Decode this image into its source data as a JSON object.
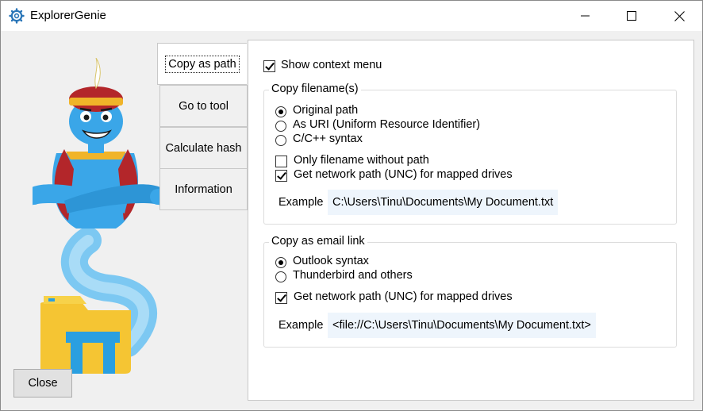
{
  "window": {
    "title": "ExplorerGenie",
    "minimize": "minimize",
    "maximize": "maximize",
    "close": "close"
  },
  "sidebar": {
    "close_label": "Close"
  },
  "tabs": [
    {
      "label": "Copy as path",
      "active": true
    },
    {
      "label": "Go to tool",
      "active": false
    },
    {
      "label": "Calculate hash",
      "active": false
    },
    {
      "label": "Information",
      "active": false
    }
  ],
  "panel": {
    "show_context_menu": {
      "label": "Show context menu",
      "checked": true
    },
    "copy_filenames": {
      "title": "Copy filename(s)",
      "options": [
        {
          "label": "Original path",
          "selected": true
        },
        {
          "label": "As URI (Uniform Resource Identifier)",
          "selected": false
        },
        {
          "label": "C/C++ syntax",
          "selected": false
        }
      ],
      "only_filename": {
        "label": "Only filename without path",
        "checked": false
      },
      "network_path": {
        "label": "Get network path (UNC) for mapped drives",
        "checked": true
      },
      "example_label": "Example",
      "example_value": "C:\\Users\\Tinu\\Documents\\My Document.txt"
    },
    "email_link": {
      "title": "Copy as email link",
      "options": [
        {
          "label": "Outlook syntax",
          "selected": true
        },
        {
          "label": "Thunderbird and others",
          "selected": false
        }
      ],
      "network_path": {
        "label": "Get network path (UNC) for mapped drives",
        "checked": true
      },
      "example_label": "Example",
      "example_value": "<file://C:\\Users\\Tinu\\Documents\\My Document.txt>"
    }
  },
  "colors": {
    "genie_skin": "#3aa6e8",
    "turban": "#b3262a",
    "folder": "#f5c533",
    "folder_blue": "#2a9fe0"
  }
}
